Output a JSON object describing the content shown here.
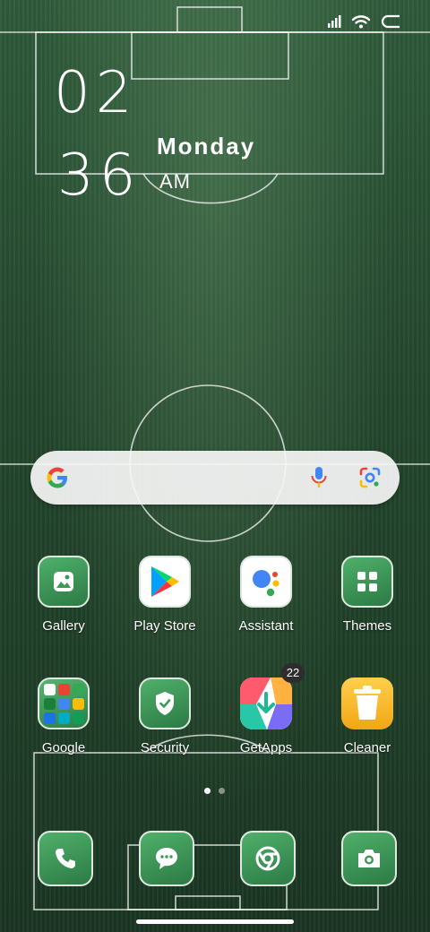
{
  "status_bar": {
    "icons": [
      "signal-icon",
      "wifi-icon",
      "battery-icon"
    ]
  },
  "clock": {
    "hour": "02",
    "minute": "36",
    "day": "Monday",
    "ampm": "AM"
  },
  "search": {
    "icons": [
      "google-g-icon",
      "mic-icon",
      "lens-icon"
    ]
  },
  "apps": [
    {
      "label": "Gallery",
      "icon": "gallery-icon"
    },
    {
      "label": "Play Store",
      "icon": "play-store-icon"
    },
    {
      "label": "Assistant",
      "icon": "assistant-icon"
    },
    {
      "label": "Themes",
      "icon": "themes-icon"
    },
    {
      "label": "Google",
      "icon": "google-folder-icon"
    },
    {
      "label": "Security",
      "icon": "security-icon"
    },
    {
      "label": "GetApps",
      "icon": "getapps-icon",
      "badge": "22"
    },
    {
      "label": "Cleaner",
      "icon": "cleaner-icon"
    }
  ],
  "page_indicator": {
    "pages": 2,
    "current": 1
  },
  "dock": [
    {
      "icon": "phone-icon"
    },
    {
      "icon": "messages-icon"
    },
    {
      "icon": "chrome-icon"
    },
    {
      "icon": "camera-icon"
    }
  ],
  "colors": {
    "wallpaper": "#24482e",
    "app_tile": "#3d9958",
    "search_bar": "#f5f5f5"
  }
}
